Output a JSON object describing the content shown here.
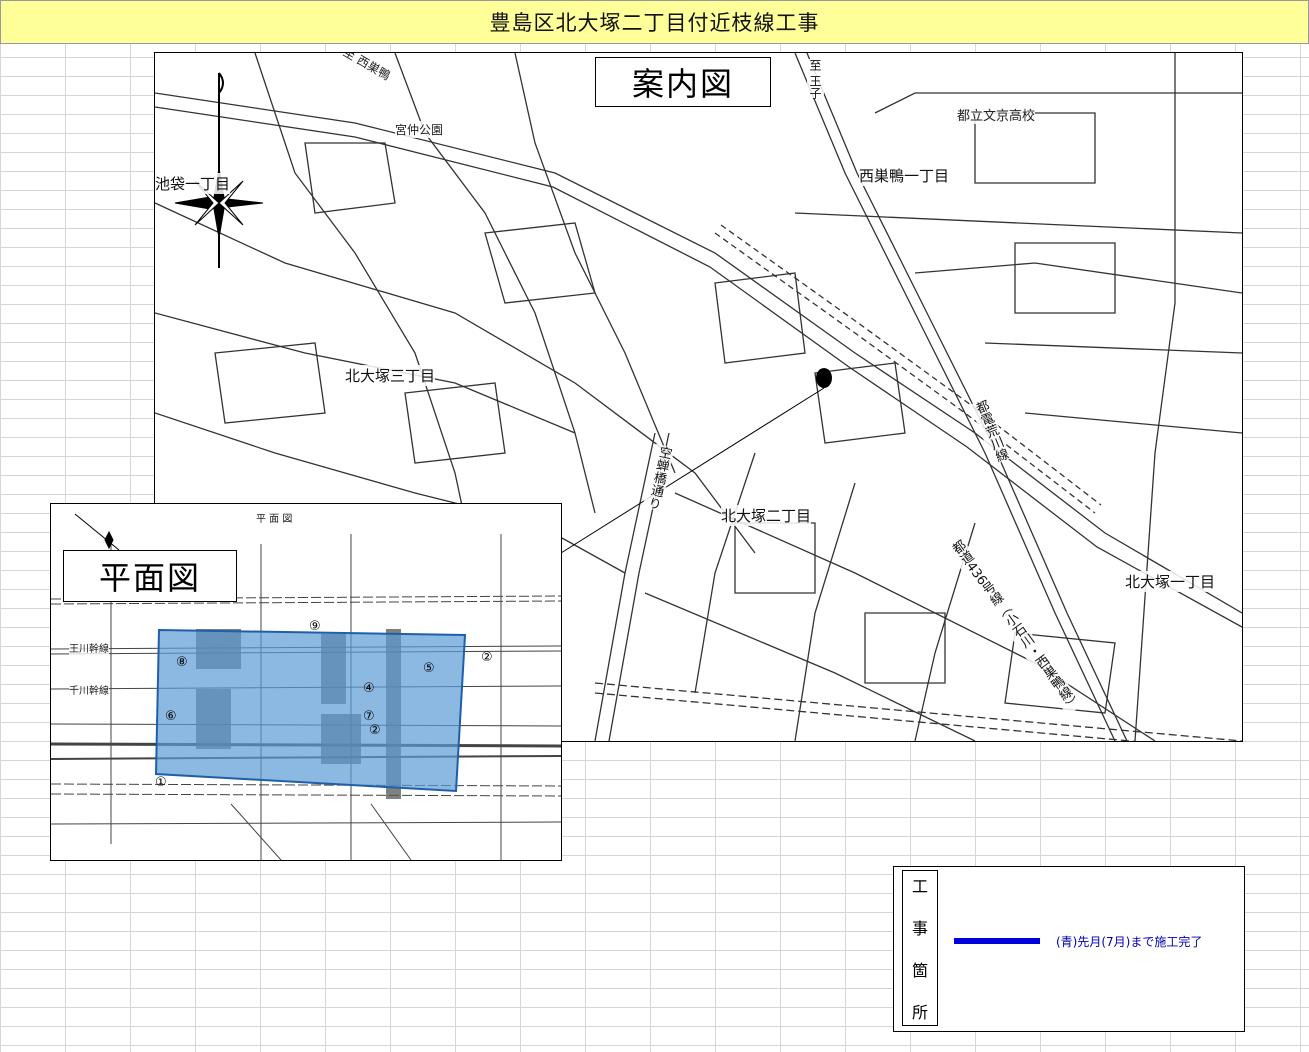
{
  "page": {
    "title": "豊島区北大塚二丁目付近枝線工事"
  },
  "guide_map": {
    "heading": "案内図",
    "places": {
      "ikebukuro": "池袋一丁目",
      "miyanaka_park": "宮仲公園",
      "nishi_sugamo": "至 西巣鴨",
      "ouji": "至 王子",
      "bunkyo_hs": "都立文京高校",
      "nishisugamo_1": "西巣鴨一丁目",
      "kitaotsuka_3": "北大塚三丁目",
      "kitaotsuka_2": "北大塚二丁目",
      "kitaotsuka_1": "北大塚一丁目"
    },
    "roads": {
      "kusuba_dori": "空蝉橋通り",
      "arakawa_line": "都電荒川線",
      "route_436": "都道436号線（小石川・西巣鴨線）"
    },
    "colors": {
      "site_marker": "#000000",
      "lines": "#333333"
    }
  },
  "plan_view": {
    "heading": "平面図",
    "sub_heading": "平 面 図",
    "labels": {
      "trunk_a": "王川幹線",
      "trunk_b": "千川幹線"
    },
    "colors": {
      "work_area": "#5b9bd5"
    }
  },
  "legend": {
    "heading_chars": [
      "工",
      "事",
      "箇",
      "所"
    ],
    "entry_text": "(青)先月(7月)まで施工完了",
    "entry_color": "#0000dd"
  }
}
